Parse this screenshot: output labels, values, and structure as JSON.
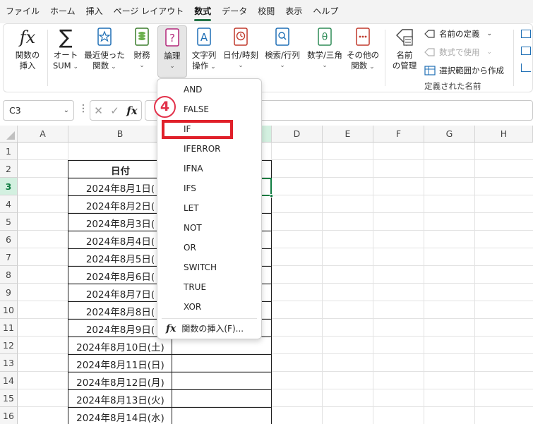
{
  "menu": {
    "tabs": [
      "ファイル",
      "ホーム",
      "挿入",
      "ページ レイアウト",
      "数式",
      "データ",
      "校閲",
      "表示",
      "ヘルプ"
    ],
    "active": "数式"
  },
  "ribbon": {
    "insert_function": [
      "関数の",
      "挿入"
    ],
    "autosum": [
      "オート",
      "SUM"
    ],
    "recent": [
      "最近使った",
      "関数"
    ],
    "financial": "財務",
    "logical": "論理",
    "text": [
      "文字列",
      "操作"
    ],
    "datetime": "日付/時刻",
    "lookup": "検索/行列",
    "math": "数学/三角",
    "more": [
      "その他の",
      "関数"
    ],
    "name_manager": [
      "名前",
      "の管理"
    ],
    "define_name": "名前の定義",
    "use_in_formula": "数式で使用",
    "create_from_selection": "選択範囲から作成",
    "defined_names_group": "定義された名前"
  },
  "formula_bar": {
    "name_box": "C3",
    "value": ""
  },
  "columns": [
    "A",
    "B",
    "C",
    "D",
    "E",
    "F",
    "G",
    "H"
  ],
  "rows": [
    "1",
    "2",
    "3",
    "4",
    "5",
    "6",
    "7",
    "8",
    "9",
    "10",
    "11",
    "12",
    "13",
    "14",
    "15",
    "16"
  ],
  "selected_cell": "C3",
  "table": {
    "header": "日付",
    "dates": [
      "2024年8月1日(",
      "2024年8月2日(",
      "2024年8月3日(",
      "2024年8月4日(",
      "2024年8月5日(",
      "2024年8月6日(",
      "2024年8月7日(",
      "2024年8月8日(",
      "2024年8月9日(",
      "2024年8月10日(土)",
      "2024年8月11日(日)",
      "2024年8月12日(月)",
      "2024年8月13日(火)",
      "2024年8月14日(水)"
    ]
  },
  "dropdown": {
    "items": [
      "AND",
      "FALSE",
      "IF",
      "IFERROR",
      "IFNA",
      "IFS",
      "LET",
      "NOT",
      "OR",
      "SWITCH",
      "TRUE",
      "XOR"
    ],
    "insert_function": "関数の挿入(F)...",
    "highlighted": "IF"
  },
  "step_badge": "4",
  "colors": {
    "accent": "#217346",
    "highlight": "#e0202a",
    "badge": "#e2314a"
  }
}
